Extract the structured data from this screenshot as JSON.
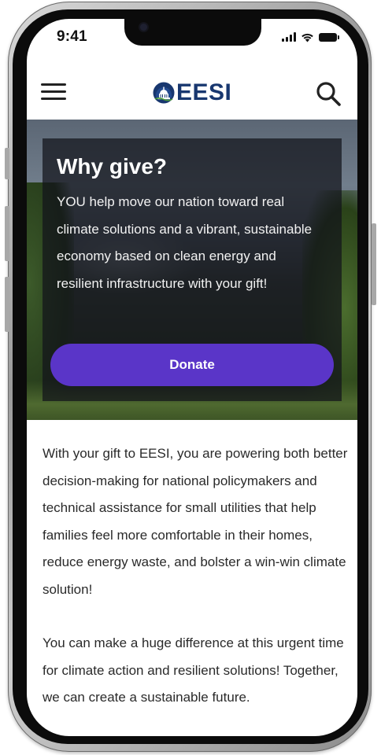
{
  "status_bar": {
    "time": "9:41"
  },
  "header": {
    "logo_text": "EESI",
    "menu_icon": "hamburger-menu-icon",
    "search_icon": "search-icon",
    "brand_color": "#18376f"
  },
  "hero": {
    "title": "Why give?",
    "body": "YOU help move our nation toward real climate solutions and a vibrant, sustainable economy based on clean energy and resilient infrastructure with your gift!",
    "donate_label": "Donate",
    "accent_color": "#5a35c8"
  },
  "content": {
    "paragraph_1": "With your gift to EESI, you are powering both better decision-making for national policymakers and technical assistance for small utilities that help families feel more comfortable in their homes, reduce energy waste, and bolster a win-win climate solution!",
    "paragraph_2": "You can make a huge difference at this urgent time for climate action and resilient solutions! Together, we can create a sustainable future."
  }
}
